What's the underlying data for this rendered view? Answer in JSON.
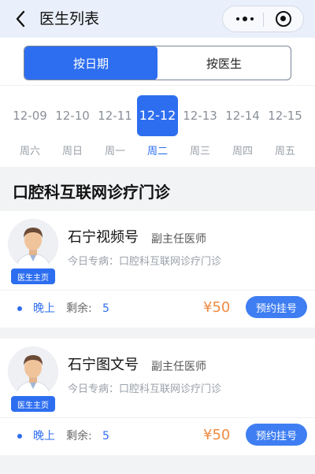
{
  "nav": {
    "title": "医生列表"
  },
  "tabs": [
    {
      "label": "按日期",
      "active": true
    },
    {
      "label": "按医生",
      "active": false
    }
  ],
  "dates": [
    {
      "date": "12-09",
      "weekday": "周六",
      "active": false
    },
    {
      "date": "12-10",
      "weekday": "周日",
      "active": false
    },
    {
      "date": "12-11",
      "weekday": "周一",
      "active": false
    },
    {
      "date": "12-12",
      "weekday": "周二",
      "active": true
    },
    {
      "date": "12-13",
      "weekday": "周三",
      "active": false
    },
    {
      "date": "12-14",
      "weekday": "周四",
      "active": false
    },
    {
      "date": "12-15",
      "weekday": "周五",
      "active": false
    }
  ],
  "section": {
    "title": "口腔科互联网诊疗门诊"
  },
  "doctors": [
    {
      "name": "石宁视频号",
      "rank": "副主任医师",
      "specialty": "今日专病：口腔科互联网诊疗门诊",
      "home_label": "医生主页",
      "slot": "晚上",
      "remain_label": "剩余:",
      "remain": "5",
      "price": "¥50",
      "book_label": "预约挂号"
    },
    {
      "name": "石宁图文号",
      "rank": "副主任医师",
      "specialty": "今日专病：口腔科互联网诊疗门诊",
      "home_label": "医生主页",
      "slot": "晚上",
      "remain_label": "剩余:",
      "remain": "5",
      "price": "¥50",
      "book_label": "预约挂号"
    }
  ],
  "colors": {
    "accent": "#2d6ef0",
    "price": "#f08a42",
    "background": "#f2f3f5"
  }
}
